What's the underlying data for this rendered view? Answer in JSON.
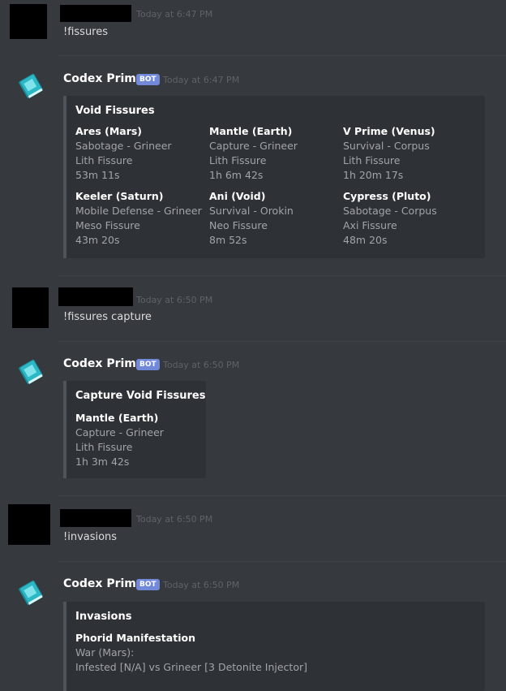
{
  "messages": [
    {
      "type": "user",
      "timestamp": "Today at 6:47 PM",
      "text": "!fissures"
    },
    {
      "type": "bot",
      "author": "Codex Prime",
      "bot_tag": "BOT",
      "timestamp": "Today at 6:47 PM",
      "embed": {
        "title": "Void Fissures",
        "fields": [
          {
            "name": "Ares (Mars)",
            "mission": "Sabotage - Grineer",
            "tier": "Lith Fissure",
            "time": "53m 11s"
          },
          {
            "name": "Mantle (Earth)",
            "mission": "Capture - Grineer",
            "tier": "Lith Fissure",
            "time": "1h 6m 42s"
          },
          {
            "name": "V Prime (Venus)",
            "mission": "Survival - Corpus",
            "tier": "Lith Fissure",
            "time": "1h 20m 17s"
          },
          {
            "name": "Keeler (Saturn)",
            "mission": "Mobile Defense - Grineer",
            "tier": "Meso Fissure",
            "time": "43m 20s"
          },
          {
            "name": "Ani (Void)",
            "mission": "Survival - Orokin",
            "tier": "Neo Fissure",
            "time": "8m 52s"
          },
          {
            "name": "Cypress (Pluto)",
            "mission": "Sabotage - Corpus",
            "tier": "Axi Fissure",
            "time": "48m 20s"
          }
        ]
      }
    },
    {
      "type": "user",
      "timestamp": "Today at 6:50 PM",
      "text": "!fissures capture"
    },
    {
      "type": "bot",
      "author": "Codex Prime",
      "bot_tag": "BOT",
      "timestamp": "Today at 6:50 PM",
      "embed": {
        "title": "Capture Void Fissures",
        "fields": [
          {
            "name": "Mantle (Earth)",
            "mission": "Capture - Grineer",
            "tier": "Lith Fissure",
            "time": "1h 3m 42s"
          }
        ]
      }
    },
    {
      "type": "user",
      "timestamp": "Today at 6:50 PM",
      "text": "!invasions"
    },
    {
      "type": "bot",
      "author": "Codex Prime",
      "bot_tag": "BOT",
      "timestamp": "Today at 6:50 PM",
      "embed": {
        "title": "Invasions",
        "fields": [
          {
            "name": "Phorid Manifestation",
            "line1": "War (Mars):",
            "line2": "Infested [N/A] vs Grineer [3 Detonite Injector]"
          }
        ]
      }
    }
  ],
  "colors": {
    "background": "#36393e",
    "embed_bg": "#2e3136",
    "embed_border": "#4f545c",
    "bot_tag": "#7289da",
    "avatar": "#2ab7c6"
  },
  "icons": {
    "bot_avatar": "codex-book-icon"
  }
}
